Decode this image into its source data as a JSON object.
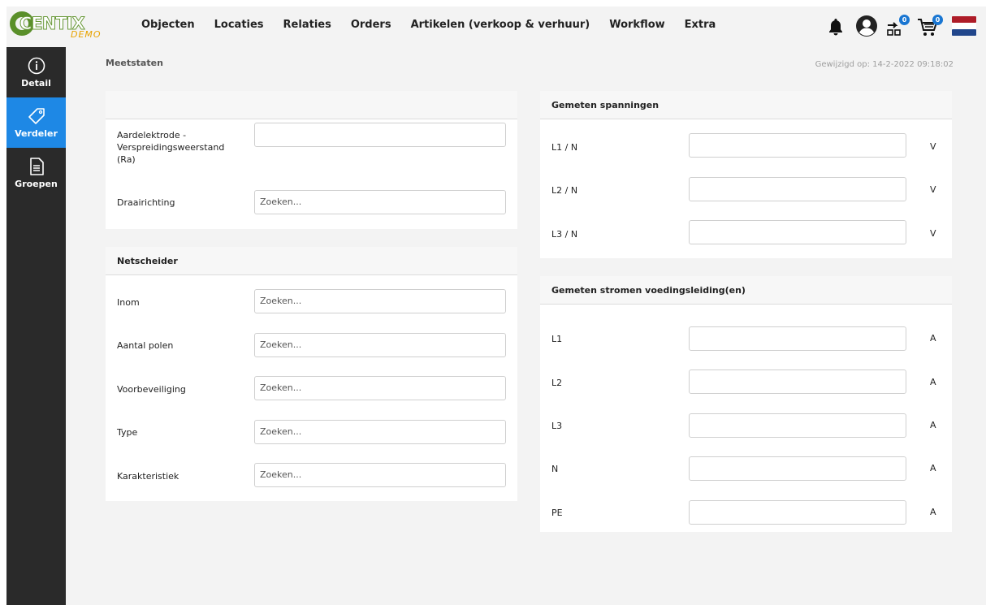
{
  "logo": {
    "text": "CENTIX",
    "sub": "DEMO"
  },
  "nav": [
    "Objecten",
    "Locaties",
    "Relaties",
    "Orders",
    "Artikelen (verkoop & verhuur)",
    "Workflow",
    "Extra"
  ],
  "toolbar": {
    "scan_badge": "0",
    "cart_badge": "0"
  },
  "sidebar": [
    {
      "label": "Detail",
      "icon": "info-icon"
    },
    {
      "label": "Verdeler",
      "icon": "tag-icon"
    },
    {
      "label": "Groepen",
      "icon": "document-icon"
    }
  ],
  "page": {
    "title": "Meetstaten",
    "modified": "Gewijzigd op: 14-2-2022 09:18:02"
  },
  "search_placeholder": "Zoeken...",
  "card1": {
    "aard_label": "Aardelektrode - Verspreidingsweerstand (Ra)",
    "draai_label": "Draairichting"
  },
  "netscheider": {
    "title": "Netscheider",
    "fields": [
      "Inom",
      "Aantal polen",
      "Voorbeveiliging",
      "Type",
      "Karakteristiek"
    ]
  },
  "spanningen": {
    "title": "Gemeten spanningen",
    "fields": [
      "L1 / N",
      "L2 / N",
      "L3 / N"
    ],
    "unit": "V"
  },
  "stromen": {
    "title": "Gemeten stromen voedingsleiding(en)",
    "fields": [
      "L1",
      "L2",
      "L3",
      "N",
      "PE"
    ],
    "unit": "A"
  },
  "colors": {
    "accent": "#1e88e5",
    "sidebar": "#2a2a2a",
    "badge": "#1976d2"
  }
}
